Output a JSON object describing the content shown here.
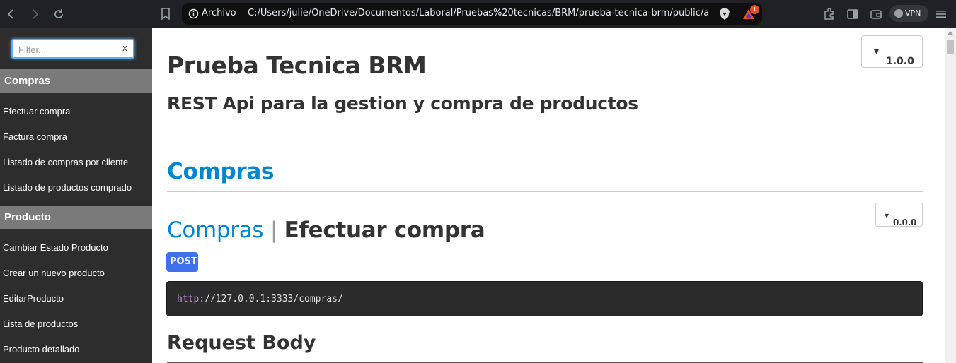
{
  "browser": {
    "url_scheme_label": "Archivo",
    "url": "C:/Users/julie/OneDrive/Documentos/Laboral/Pruebas%20tecnicas/BRM/prueba-tecnica-brm/public/ap...",
    "rewards_badge": "1",
    "vpn_label": "VPN",
    "icons": {
      "back": "arrow-left-icon",
      "forward": "arrow-right-icon",
      "reload": "reload-icon",
      "bookmark": "bookmark-icon",
      "info": "info-icon",
      "shields": "brave-shield-icon",
      "rewards": "brave-rewards-icon",
      "extensions": "puzzle-icon",
      "sidebar": "sidebar-icon",
      "wallet": "wallet-icon",
      "menu": "hamburger-menu-icon"
    }
  },
  "sidebar": {
    "filter_placeholder": "Filter...",
    "filter_clear": "x",
    "groups": [
      {
        "header": "Compras",
        "items": [
          "Efectuar compra",
          "Factura compra",
          "Listado de compras por cliente",
          "Listado de productos comprado"
        ]
      },
      {
        "header": "Producto",
        "items": [
          "Cambiar Estado Producto",
          "Crear un nuevo producto",
          "EditarProducto",
          "Lista de productos",
          "Producto detallado"
        ]
      }
    ]
  },
  "main": {
    "title": "Prueba Tecnica BRM",
    "subtitle": "REST Api para la gestion y compra de productos",
    "version_selector": "1.0.0",
    "section_title": "Compras",
    "endpoint": {
      "version_selector": "0.0.0",
      "group": "Compras",
      "separator": "|",
      "name": "Efectuar compra",
      "method": "POST",
      "url_scheme": "http",
      "url_rest": "://127.0.0.1:3333/compras/",
      "request_body_title": "Request Body"
    }
  },
  "colors": {
    "sidebar_bg": "#2d2d2d",
    "sidebar_header_bg": "#7a7a7a",
    "link_blue": "#0088cc",
    "method_badge": "#4070ec",
    "code_bg": "#2b2b2b"
  }
}
